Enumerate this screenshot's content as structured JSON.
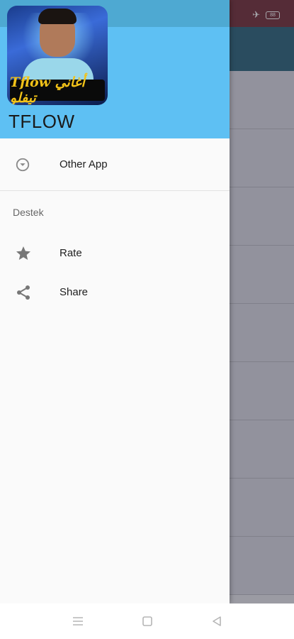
{
  "status_bar": {
    "airplane_icon": "airplane-icon",
    "battery_level": "88"
  },
  "drawer": {
    "header": {
      "app_name": "TFLOW",
      "avatar_banner_text": "Tflow أغاني تيفلو"
    },
    "items": [
      {
        "label": "Other App",
        "icon": "chevron-down-circle-icon"
      }
    ],
    "section": {
      "label": "Destek",
      "items": [
        {
          "label": "Rate",
          "icon": "star-icon"
        },
        {
          "label": "Share",
          "icon": "share-icon"
        }
      ]
    }
  },
  "colors": {
    "header_bg": "#5ec0f3",
    "drawer_status_bg": "#4ea9d2",
    "background_statusbar": "#6b1f2a",
    "background_toolbar": "#1d5a73"
  },
  "navbar": {
    "buttons": [
      "menu-icon",
      "home-icon",
      "back-icon"
    ]
  }
}
